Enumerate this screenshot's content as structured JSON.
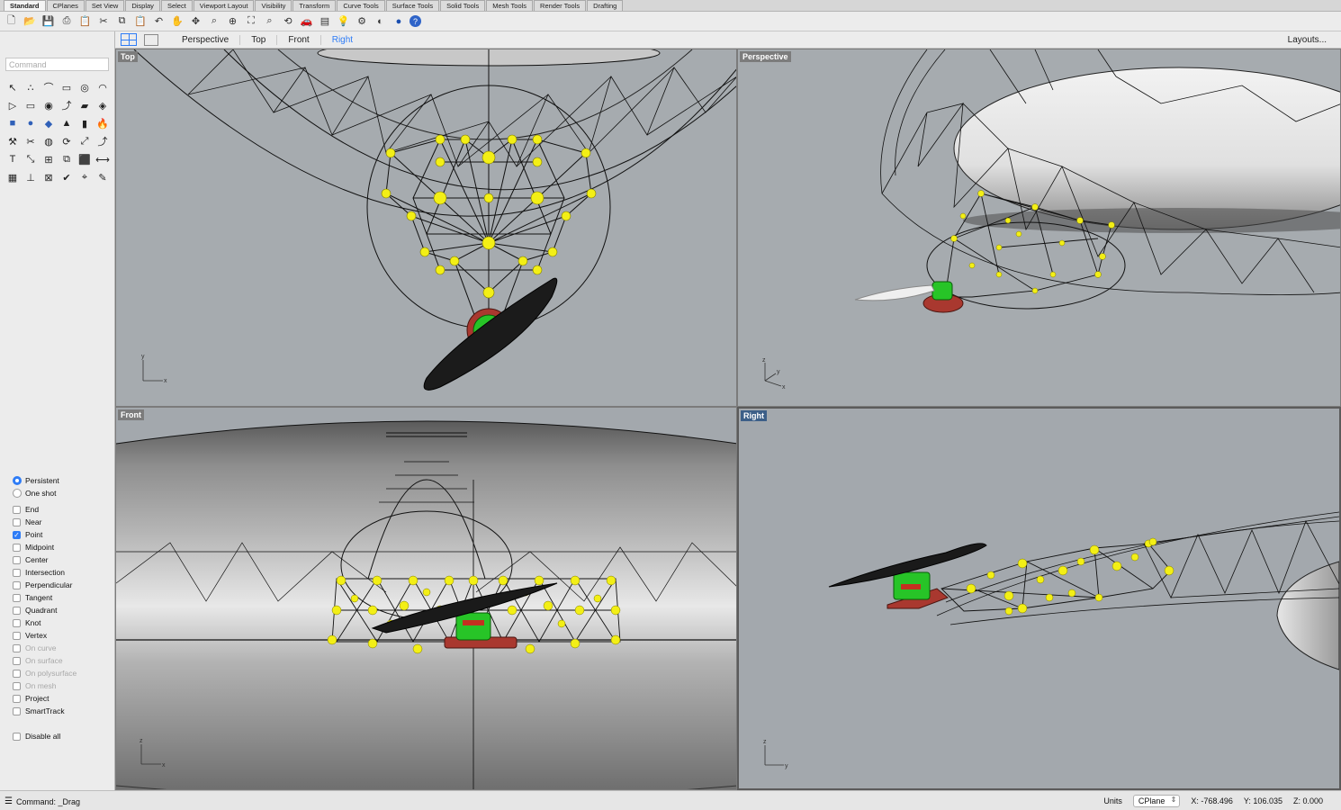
{
  "tabs": [
    "Standard",
    "CPlanes",
    "Set View",
    "Display",
    "Select",
    "Viewport Layout",
    "Visibility",
    "Transform",
    "Curve Tools",
    "Surface Tools",
    "Solid Tools",
    "Mesh Tools",
    "Render Tools",
    "Drafting"
  ],
  "active_tab": "Standard",
  "toolbar_icons": [
    "new-file-icon",
    "open-file-icon",
    "save-icon",
    "print-icon",
    "paste-icon",
    "cut-icon",
    "copy-icon",
    "paste-clipboard-icon",
    "undo-icon",
    "pan-hand-icon",
    "move-icon",
    "zoom-icon",
    "zoom-window-icon",
    "zoom-extents-icon",
    "zoom-selected-icon",
    "rotate-view-icon",
    "car-icon",
    "layer-icon",
    "bulb-icon",
    "properties-icon",
    "material-icon",
    "render-sphere-icon",
    "help-icon"
  ],
  "command": {
    "placeholder": "Command"
  },
  "tool_icons": [
    "select-arrow-icon",
    "point-icon",
    "polyline-icon",
    "rectangle-icon",
    "circle-icon",
    "arc-icon",
    "curve-icon",
    "rectangle-tool-icon",
    "circle-tool-icon",
    "curve-tool-icon",
    "surface-icon",
    "surface-edge-icon",
    "box-icon",
    "sphere-icon",
    "solid-icon",
    "extrude-icon",
    "cylinder-icon",
    "fire-icon",
    "trim-icon",
    "split-icon",
    "boolean-icon",
    "join-icon",
    "move-tool-icon",
    "rotate-tool-icon",
    "text-icon",
    "scale-icon",
    "transform-icon",
    "mirror-icon",
    "cube-icon",
    "dimension-icon",
    "array-icon",
    "align-icon",
    "group-icon",
    "check-icon",
    "analyze-icon",
    "edit-icon"
  ],
  "viewport_tabs": [
    "Perspective",
    "Top",
    "Front",
    "Right"
  ],
  "active_viewport_tab": "Right",
  "layouts_label": "Layouts...",
  "viewports": {
    "top": "Top",
    "perspective": "Perspective",
    "front": "Front",
    "right": "Right"
  },
  "axis_labels": {
    "x": "x",
    "y": "y",
    "z": "z"
  },
  "snap_mode": {
    "persistent": "Persistent",
    "one_shot": "One shot",
    "selected": "Persistent"
  },
  "osnaps": [
    {
      "label": "End",
      "checked": false,
      "enabled": true
    },
    {
      "label": "Near",
      "checked": false,
      "enabled": true
    },
    {
      "label": "Point",
      "checked": true,
      "enabled": true
    },
    {
      "label": "Midpoint",
      "checked": false,
      "enabled": true
    },
    {
      "label": "Center",
      "checked": false,
      "enabled": true
    },
    {
      "label": "Intersection",
      "checked": false,
      "enabled": true
    },
    {
      "label": "Perpendicular",
      "checked": false,
      "enabled": true
    },
    {
      "label": "Tangent",
      "checked": false,
      "enabled": true
    },
    {
      "label": "Quadrant",
      "checked": false,
      "enabled": true
    },
    {
      "label": "Knot",
      "checked": false,
      "enabled": true
    },
    {
      "label": "Vertex",
      "checked": false,
      "enabled": true
    },
    {
      "label": "On curve",
      "checked": false,
      "enabled": false
    },
    {
      "label": "On surface",
      "checked": false,
      "enabled": false
    },
    {
      "label": "On polysurface",
      "checked": false,
      "enabled": false
    },
    {
      "label": "On mesh",
      "checked": false,
      "enabled": false
    },
    {
      "label": "Project",
      "checked": false,
      "enabled": true
    },
    {
      "label": "SmartTrack",
      "checked": false,
      "enabled": true
    }
  ],
  "disable_all": "Disable all",
  "status": {
    "command": "Command: _Drag",
    "units_label": "Units",
    "cplane": "CPlane",
    "x": "X: -768.496",
    "y": "Y: 106.035",
    "z": "Z: 0.000"
  },
  "colors": {
    "accent": "#2e7cf6",
    "viewport_bg": "#a3a8ad",
    "joint": "#f3ef16",
    "motor_green": "#27c427",
    "mount_red": "#a9382f",
    "active_label": "#3c5f88"
  }
}
